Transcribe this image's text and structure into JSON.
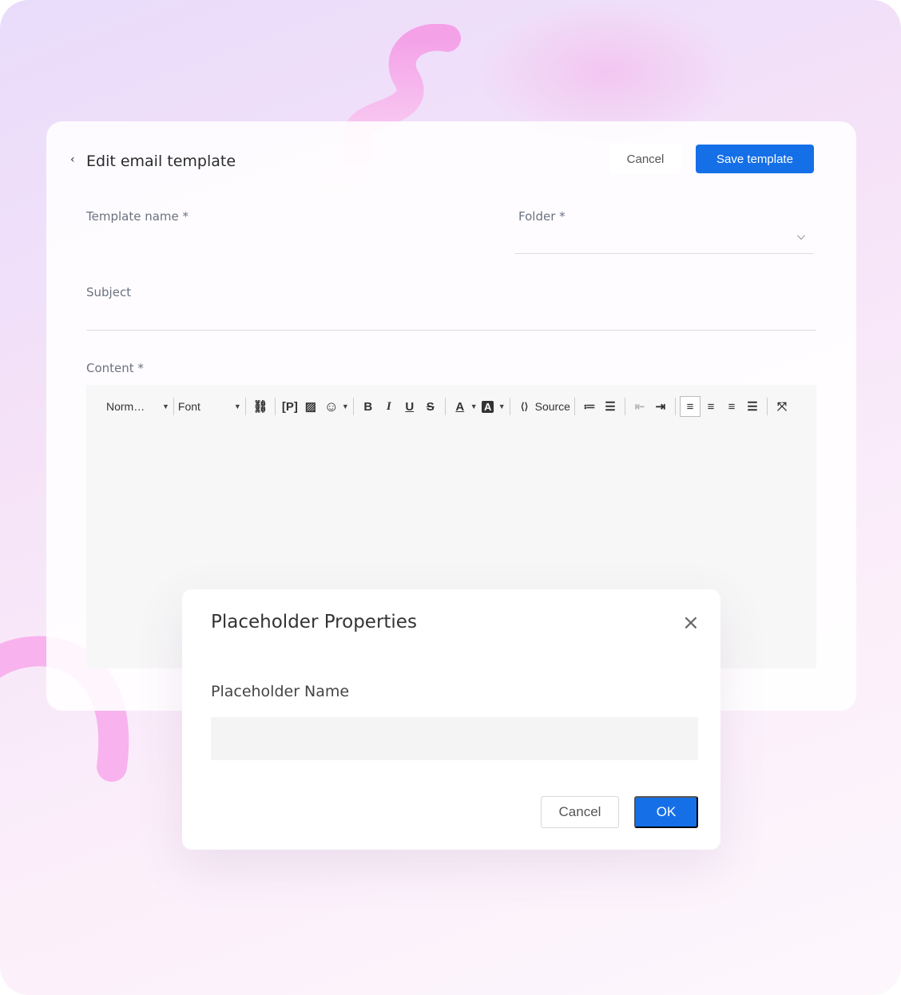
{
  "header": {
    "title": "Edit email template",
    "cancel_label": "Cancel",
    "save_label": "Save template"
  },
  "form": {
    "template_name_label": "Template name *",
    "folder_label": "Folder *",
    "subject_label": "Subject",
    "content_label": "Content *"
  },
  "toolbar": {
    "format": "Norm…",
    "font": "Font",
    "source": "Source"
  },
  "dialog": {
    "title": "Placeholder Properties",
    "name_label": "Placeholder Name",
    "name_value": "",
    "cancel_label": "Cancel",
    "ok_label": "OK",
    "close": "×"
  },
  "colors": {
    "accent": "#1570e8"
  }
}
